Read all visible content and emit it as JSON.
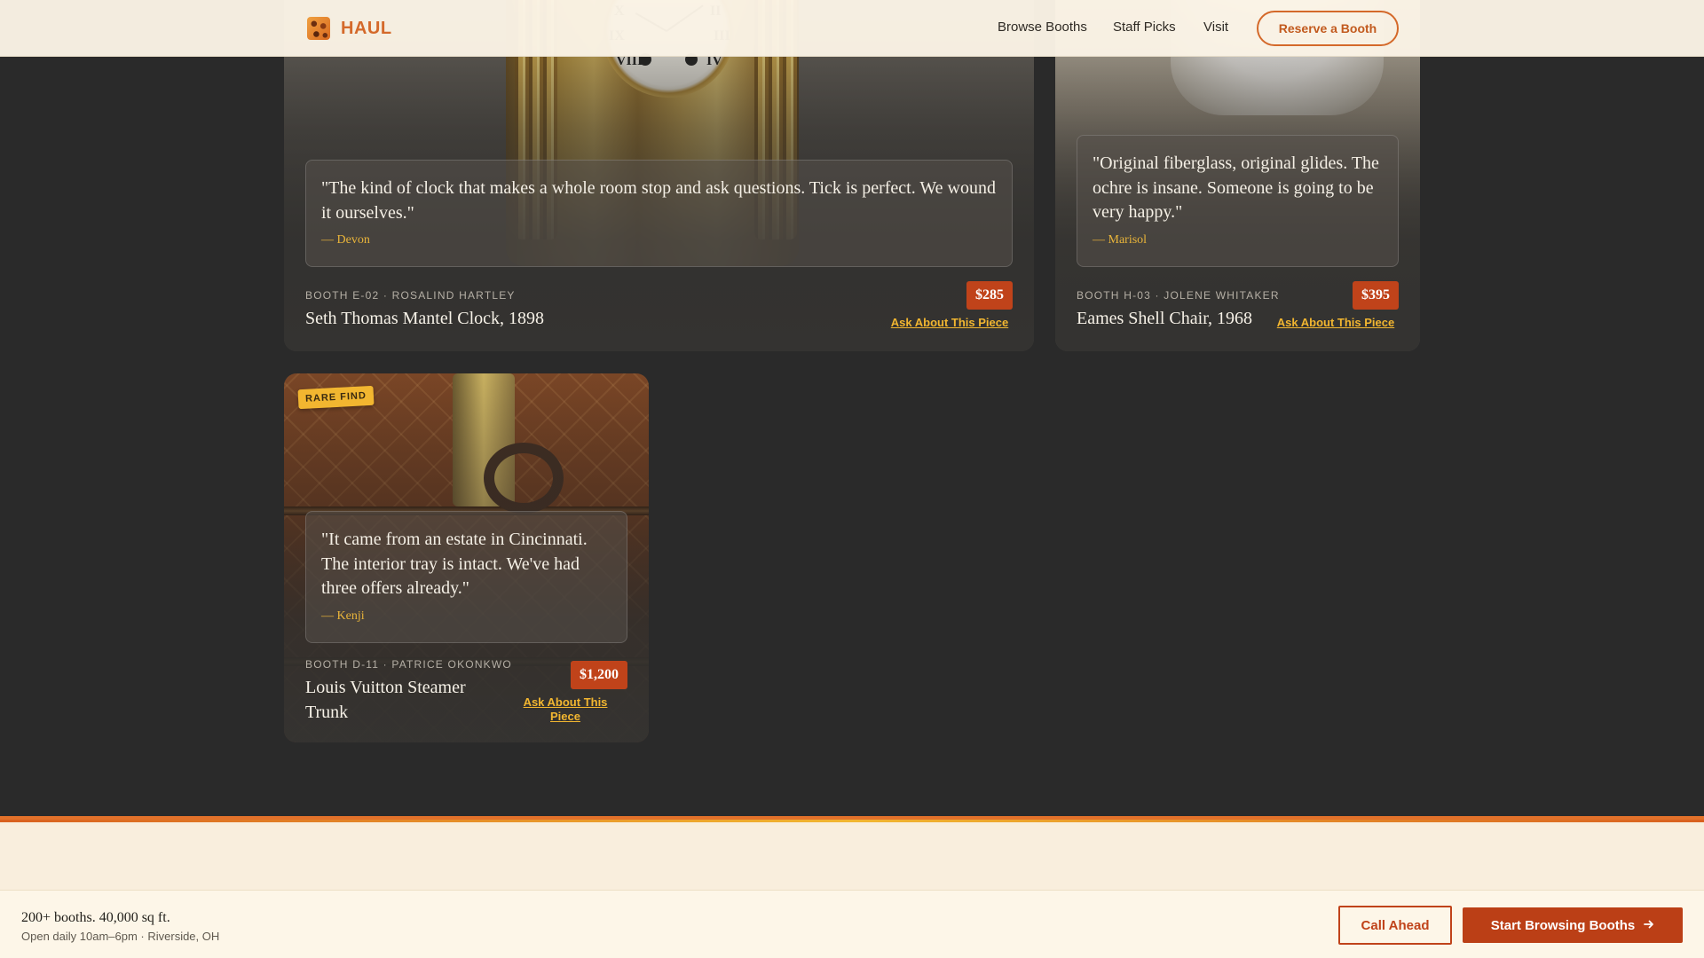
{
  "brand": {
    "name": "HAUL",
    "accent": "#d4692a"
  },
  "nav": {
    "items": [
      "Browse Booths",
      "Staff Picks",
      "Visit"
    ],
    "cta": "Reserve a Booth"
  },
  "cards": [
    {
      "quote": "\"The kind of clock that makes a whole room stop and ask questions. Tick is perfect. We wound it ourselves.\"",
      "author": "— Devon",
      "booth": "BOOTH E-02 · ROSALIND HARTLEY",
      "title": "Seth Thomas Mantel Clock, 1898",
      "price": "$285",
      "ask": "Ask About This Piece",
      "image": "mantel-clock-photo"
    },
    {
      "quote": "\"Original fiberglass, original glides. The ochre is insane. Someone is going to be very happy.\"",
      "author": "— Marisol",
      "booth": "BOOTH H-03 · JOLENE WHITAKER",
      "title": "Eames Shell Chair, 1968",
      "price": "$395",
      "ask": "Ask About This Piece",
      "image": "shell-chair-photo"
    },
    {
      "badge": "RARE FIND",
      "quote": "\"It came from an estate in Cincinnati. The interior tray is intact. We've had three offers already.\"",
      "author": "— Kenji",
      "booth": "BOOTH D-11 · PATRICE OKONKWO",
      "title": "Louis Vuitton Steamer Trunk",
      "price": "$1,200",
      "ask": "Ask About This Piece",
      "image": "steamer-trunk-photo"
    }
  ],
  "bottom_bar": {
    "headline": "200+ booths. 40,000 sq ft.",
    "sub": "Open daily 10am–6pm · Riverside, OH",
    "call": "Call Ahead",
    "start": "Start Browsing Booths",
    "start_icon": "arrow-right-icon"
  },
  "colors": {
    "price": "#c0431a",
    "link": "#f2b630",
    "page_bg": "#2a2a2a",
    "cream": "#fdf6e8"
  }
}
